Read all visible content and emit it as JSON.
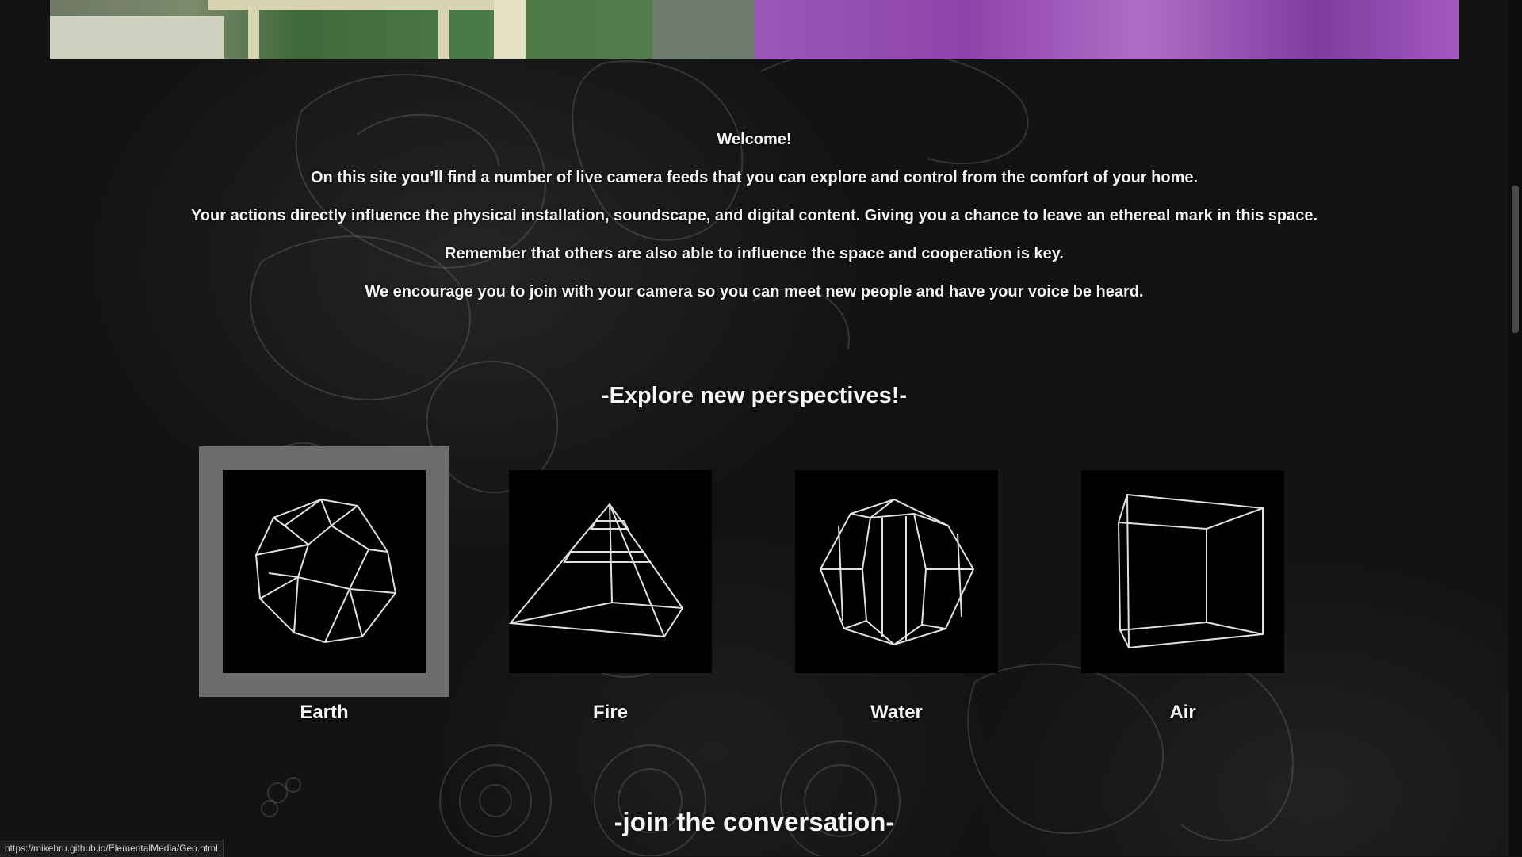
{
  "intro": {
    "welcome": "Welcome!",
    "line1": "On this site you’ll find a number of live camera feeds that you can explore and control from the comfort of your home.",
    "line2": "Your actions directly influence the physical installation, soundscape, and digital content. Giving you a chance to leave an ethereal mark in this space.",
    "line3": "Remember that others are also able to influence the space and cooperation is key.",
    "line4": "We encourage you to join with your camera so you can meet new people and have your voice be heard."
  },
  "explore_heading": "-Explore new perspectives!-",
  "elements": [
    {
      "label": "Earth",
      "icon": "icosahedron-icon",
      "selected": true
    },
    {
      "label": "Fire",
      "icon": "pyramid-icon",
      "selected": false
    },
    {
      "label": "Water",
      "icon": "polyhedron-icon",
      "selected": false
    },
    {
      "label": "Air",
      "icon": "cube-icon",
      "selected": false
    }
  ],
  "join_heading": "-join the conversation-",
  "status_url": "https://mikebru.github.io/ElementalMedia/Geo.html",
  "colors": {
    "background": "#131313",
    "text": "#f5f5f5",
    "selected_frame": "#6c6c6c",
    "tile": "#000000"
  }
}
